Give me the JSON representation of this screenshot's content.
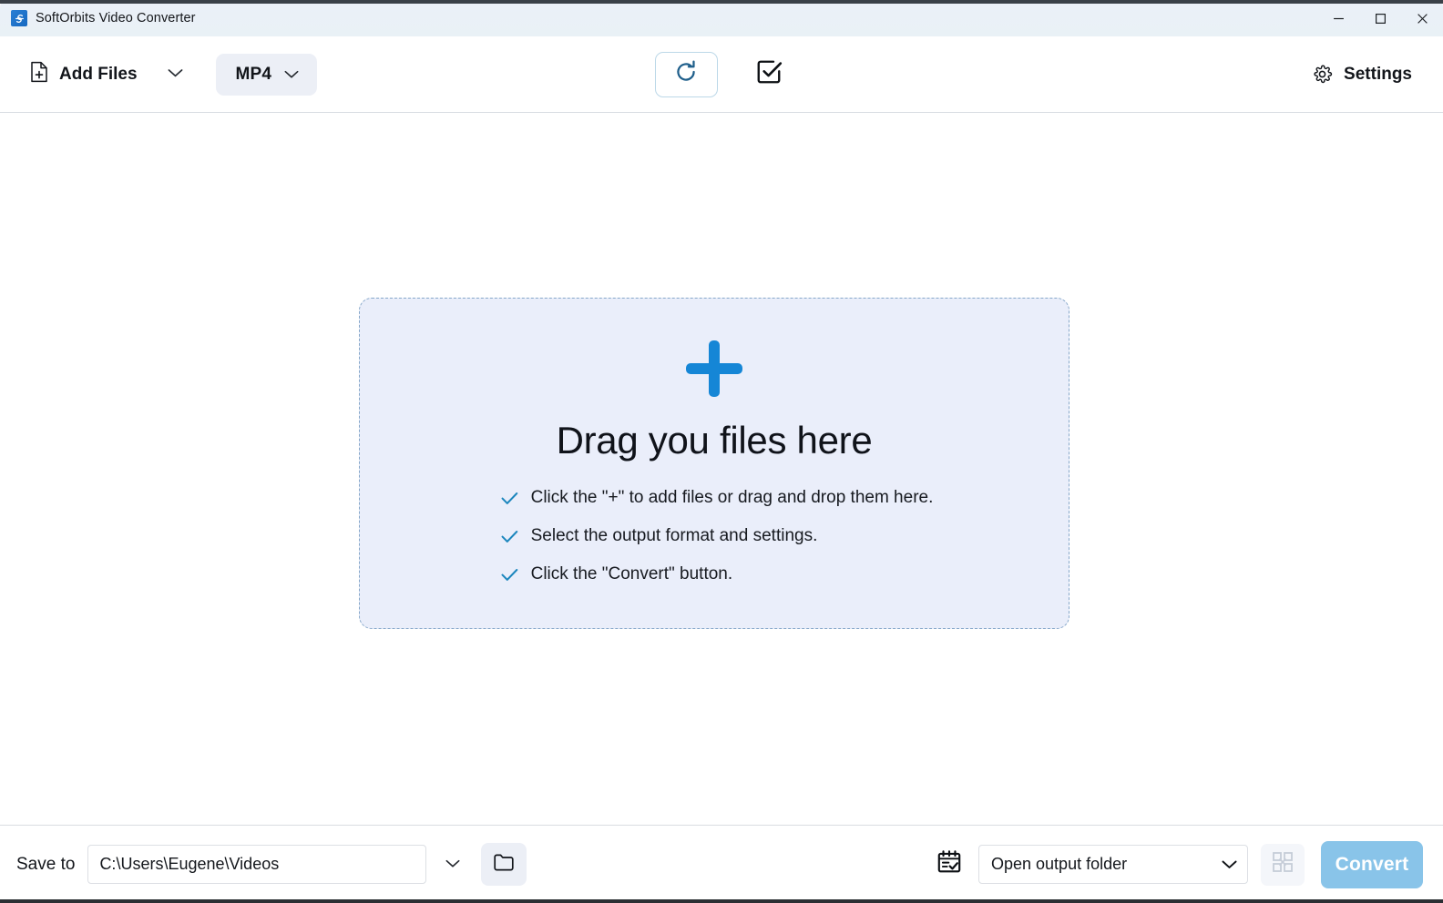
{
  "window": {
    "title": "SoftOrbits Video Converter",
    "app_icon": "app-logo-icon",
    "controls": {
      "minimize": "minimize-icon",
      "maximize": "maximize-icon",
      "close": "close-icon"
    }
  },
  "toolbar": {
    "add_files_label": "Add Files",
    "add_files_icon": "document-add-icon",
    "add_files_dropdown_icon": "chevron-down-icon",
    "format_label": "MP4",
    "format_dropdown_icon": "chevron-down-icon",
    "refresh_icon": "refresh-icon",
    "select_all_icon": "checkbox-checked-icon",
    "settings_label": "Settings",
    "settings_icon": "gear-icon"
  },
  "dropzone": {
    "plus_icon": "plus-icon",
    "title": "Drag you files here",
    "bullets": [
      {
        "check_icon": "check-icon",
        "text": "Click the \"+\" to add files or drag and drop them here."
      },
      {
        "check_icon": "check-icon",
        "text": "Select the output format and settings."
      },
      {
        "check_icon": "check-icon",
        "text": "Click the \"Convert\" button."
      }
    ]
  },
  "bottom_bar": {
    "save_to_label": "Save to",
    "save_to_value": "C:\\Users\\Eugene\\Videos",
    "save_to_placeholder": "C:\\Users\\Eugene\\Videos",
    "save_to_dropdown_icon": "chevron-down-icon",
    "browse_folder_icon": "folder-icon",
    "post_action_icon": "calendar-check-icon",
    "post_action_value": "Open output folder",
    "post_action_dropdown_icon": "chevron-down-icon",
    "merge_icon": "merge-files-icon",
    "convert_label": "Convert"
  },
  "colors": {
    "accent_blue": "#1586d6",
    "titlebar_bg": "#eaf0f8",
    "dropzone_bg": "#eaeefa",
    "dropzone_border": "#86a7c9",
    "check_teal": "#1b86bd",
    "convert_disabled": "#89c4e9",
    "chip_bg": "#eceff6"
  }
}
